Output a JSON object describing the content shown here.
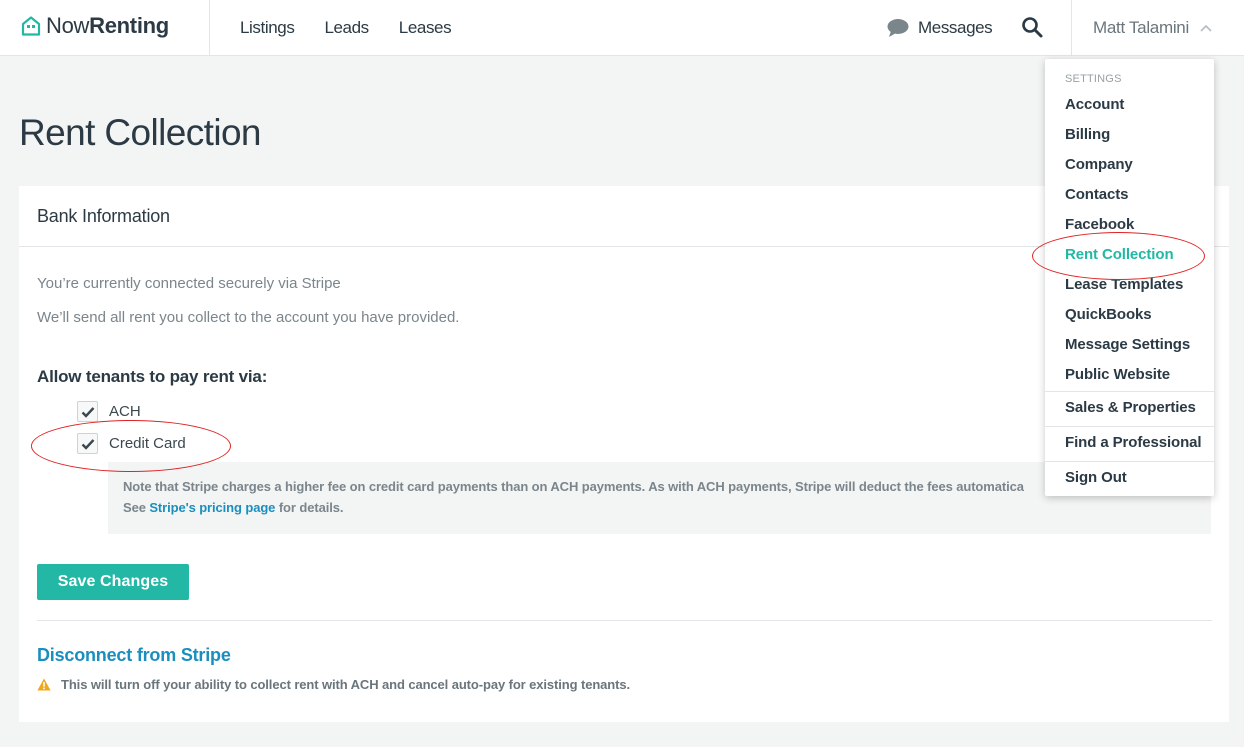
{
  "header": {
    "brand_part1": "Now",
    "brand_part2": "Renting",
    "nav": [
      "Listings",
      "Leads",
      "Leases"
    ],
    "messages_label": "Messages",
    "user_name": "Matt Talamini"
  },
  "page": {
    "title": "Rent Collection"
  },
  "bank": {
    "heading": "Bank Information",
    "connected_text": "You’re currently connected securely via Stripe",
    "send_text": "We’ll send all rent you collect to the account you have provided.",
    "allow_label": "Allow tenants to pay rent via:",
    "options": [
      {
        "label": "ACH",
        "checked": true
      },
      {
        "label": "Credit Card",
        "checked": true
      }
    ],
    "note_line1": "Note that Stripe charges a higher fee on credit card payments than on ACH payments. As with ACH payments, Stripe will deduct the fees automatica",
    "note_see": "See ",
    "note_link": "Stripe's pricing page",
    "note_after": " for details.",
    "save_label": "Save Changes",
    "disconnect_label": "Disconnect from Stripe",
    "warning_text": "This will turn off your ability to collect rent with ACH and cancel auto-pay for existing tenants."
  },
  "dropdown": {
    "heading": "SETTINGS",
    "items": [
      "Account",
      "Billing",
      "Company",
      "Contacts",
      "Facebook",
      "Rent Collection",
      "Lease Templates",
      "QuickBooks",
      "Message Settings",
      "Public Website"
    ],
    "active": "Rent Collection",
    "group2": [
      "Sales & Properties"
    ],
    "group3": [
      "Find a Professional"
    ],
    "group4": [
      "Sign Out"
    ]
  },
  "colors": {
    "accent": "#22b8a5",
    "link": "#1a8fbf",
    "annotation": "#e02424",
    "warning": "#f0a818"
  }
}
